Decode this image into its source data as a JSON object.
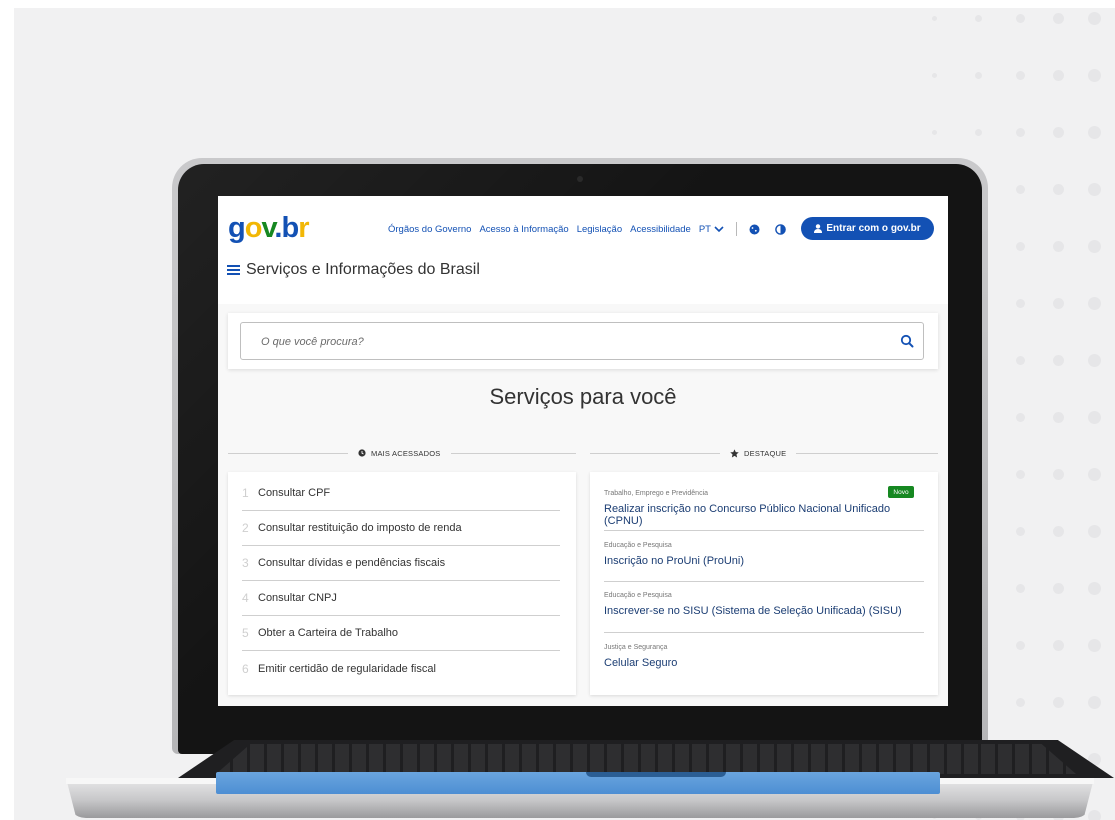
{
  "header": {
    "logo": {
      "g": "g",
      "o": "o",
      "v": "v",
      "dot": ".",
      "b": "b",
      "r": "r"
    },
    "nav": [
      "Órgãos do Governo",
      "Acesso à Informação",
      "Legislação",
      "Acessibilidade"
    ],
    "language": "PT",
    "login_label": "Entrar com o gov.br",
    "menu_title": "Serviços e Informações do Brasil"
  },
  "search": {
    "placeholder": "O que você procura?"
  },
  "main": {
    "title": "Serviços para você"
  },
  "mais_acessados": {
    "label": "MAIS ACESSADOS",
    "items": [
      {
        "num": "1",
        "text": "Consultar CPF"
      },
      {
        "num": "2",
        "text": "Consultar restituição do imposto de renda"
      },
      {
        "num": "3",
        "text": "Consultar dívidas e pendências fiscais"
      },
      {
        "num": "4",
        "text": "Consultar CNPJ"
      },
      {
        "num": "5",
        "text": "Obter a Carteira de Trabalho"
      },
      {
        "num": "6",
        "text": "Emitir certidão de regularidade fiscal"
      }
    ]
  },
  "destaque": {
    "label": "DESTAQUE",
    "badge": "Novo",
    "items": [
      {
        "category": "Trabalho, Emprego e Previdência",
        "text": "Realizar inscrição no Concurso Público Nacional Unificado (CPNU)"
      },
      {
        "category": "Educação e Pesquisa",
        "text": "Inscrição no ProUni (ProUni)"
      },
      {
        "category": "Educação e Pesquisa",
        "text": "Inscrever-se no SISU (Sistema de Seleção Unificada) (SISU)"
      },
      {
        "category": "Justiça e Segurança",
        "text": "Celular Seguro"
      }
    ]
  },
  "colors": {
    "primary": "#1351b4",
    "accent_yellow": "#f2b705",
    "accent_green": "#168821",
    "touchpad": "#4d8ed3"
  }
}
